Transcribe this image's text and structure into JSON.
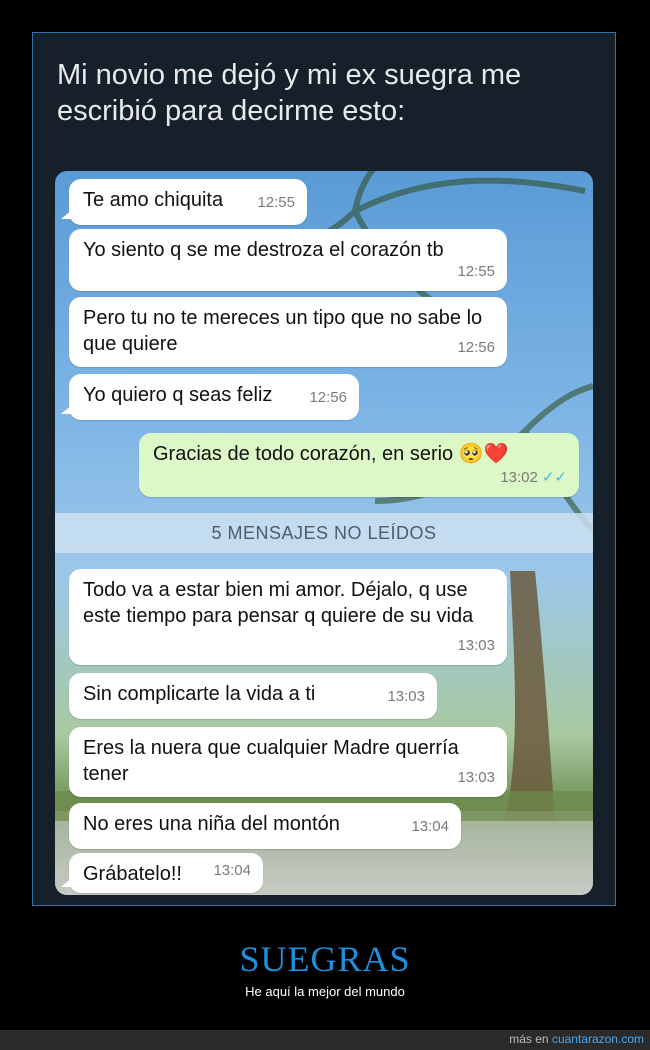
{
  "tweet": {
    "text": "Mi novio me dejó y mi ex suegra me escribió para decirme esto:"
  },
  "chat": {
    "unread_label": "5 MENSAJES NO LEÍDOS",
    "messages": [
      {
        "text": "Te amo chiquita",
        "time": "12:55",
        "dir": "in"
      },
      {
        "text": "Yo siento q se me destroza el corazón tb",
        "time": "12:55",
        "dir": "in"
      },
      {
        "text": "Pero tu no te mereces un tipo que no sabe lo que quiere",
        "time": "12:56",
        "dir": "in"
      },
      {
        "text": "Yo quiero q seas feliz",
        "time": "12:56",
        "dir": "in"
      },
      {
        "text": "Gracias de todo corazón, en serio 🥺❤️",
        "time": "13:02",
        "dir": "out",
        "ticks": "✓✓"
      },
      {
        "text": "Todo va a estar bien mi amor. Déjalo, q use este tiempo para pensar q quiere de su vida",
        "time": "13:03",
        "dir": "in"
      },
      {
        "text": "Sin complicarte la vida a ti",
        "time": "13:03",
        "dir": "in"
      },
      {
        "text": "Eres la nuera que cualquier Madre querría tener",
        "time": "13:03",
        "dir": "in"
      },
      {
        "text": "No eres una niña del montón",
        "time": "13:04",
        "dir": "in"
      },
      {
        "text": "Grábatelo!!",
        "time": "13:04",
        "dir": "in"
      }
    ]
  },
  "category": {
    "title": "SUEGRAS",
    "subtitle": "He aquí la mejor del mundo"
  },
  "footer": {
    "prefix": "más en",
    "site": "cuantarazon.com"
  },
  "colors": {
    "category_title": "#1e90e0",
    "bubble_in": "#ffffff",
    "bubble_out": "#dcf8c6",
    "read_ticks": "#4fb6ec"
  }
}
